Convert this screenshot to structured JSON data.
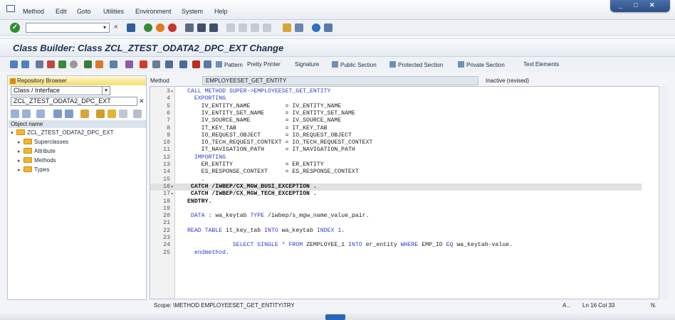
{
  "menu": {
    "items": [
      "Method",
      "Edit",
      "Goto",
      "Utilities",
      "Environment",
      "System",
      "Help"
    ]
  },
  "window_controls": [
    "_",
    "□",
    "✕"
  ],
  "command_field": {
    "value": "",
    "placeholder": ""
  },
  "title": "Class Builder: Class ZCL_ZTEST_ODATA2_DPC_EXT Change",
  "app_toolbar": {
    "pattern": "Pattern",
    "pretty_printer": "Pretty Printer",
    "signature": "Signature",
    "public_section": "Public Section",
    "protected_section": "Protected Section",
    "private_section": "Private Section",
    "text_elements": "Text Elements"
  },
  "left_pane": {
    "repository_browser": "Repository Browser",
    "object_type": "Class / Interface",
    "object_value": "ZCL_ZTEST_ODATA2_DPC_EXT",
    "object_name_header": "Object name",
    "tree": {
      "root": "ZCL_ZTEST_ODATA2_DPC_EXT",
      "children": [
        "Superclasses",
        "Attribute",
        "Methods",
        "Types"
      ]
    }
  },
  "editor_header": {
    "method_label": "Method",
    "method_name": "EMPLOYEESET_GET_ENTITY",
    "status": "Inactive (revised)"
  },
  "code": [
    {
      "n": "3",
      "mark": "▸",
      "text": "CALL METHOD SUPER->EMPLOYEESET_GET_ENTITY",
      "style": "kw"
    },
    {
      "n": "4",
      "mark": "",
      "text": "  EXPORTING",
      "style": "kw"
    },
    {
      "n": "5",
      "mark": "",
      "text": "    IV_ENTITY_NAME          = IV_ENTITY_NAME",
      "style": "plain"
    },
    {
      "n": "6",
      "mark": "",
      "text": "    IV_ENTITY_SET_NAME      = IV_ENTITY_SET_NAME",
      "style": "plain"
    },
    {
      "n": "7",
      "mark": "",
      "text": "    IV_SOURCE_NAME          = IV_SOURCE_NAME",
      "style": "plain"
    },
    {
      "n": "8",
      "mark": "",
      "text": "    IT_KEY_TAB              = IT_KEY_TAB",
      "style": "plain"
    },
    {
      "n": "9",
      "mark": "",
      "text": "    IO_REQUEST_OBJECT       = IO_REQUEST_OBJECT",
      "style": "plain"
    },
    {
      "n": "10",
      "mark": "",
      "text": "    IO_TECH_REQUEST_CONTEXT = IO_TECH_REQUEST_CONTEXT",
      "style": "plain"
    },
    {
      "n": "11",
      "mark": "",
      "text": "    IT_NAVIGATION_PATH      = IT_NAVIGATION_PATH",
      "style": "plain"
    },
    {
      "n": "12",
      "mark": "",
      "text": "  IMPORTING",
      "style": "kw"
    },
    {
      "n": "13",
      "mark": "",
      "text": "    ER_ENTITY               = ER_ENTITY",
      "style": "plain"
    },
    {
      "n": "14",
      "mark": "",
      "text": "    ES_RESPONSE_CONTEXT     = ES_RESPONSE_CONTEXT",
      "style": "plain"
    },
    {
      "n": "15",
      "mark": "",
      "text": "    .",
      "style": "plain"
    },
    {
      "n": "16",
      "mark": "▸",
      "text": " CATCH /IWBEP/CX_MGW_BUSI_EXCEPTION .",
      "style": "bold",
      "highlight": true
    },
    {
      "n": "17",
      "mark": "▸",
      "text": " CATCH /IWBEP/CX_MGW_TECH_EXCEPTION .",
      "style": "bold"
    },
    {
      "n": "18",
      "mark": "",
      "text": "ENDTRY.",
      "style": "bold"
    },
    {
      "n": "19",
      "mark": "",
      "text": "",
      "style": "plain"
    },
    {
      "n": "20",
      "mark": "",
      "text": " DATA : wa_keytab TYPE /iwbep/s_mgw_name_value_pair.",
      "style": "mixed1"
    },
    {
      "n": "21",
      "mark": "",
      "text": "",
      "style": "plain"
    },
    {
      "n": "22",
      "mark": "",
      "text": "READ TABLE it_key_tab INTO wa_keytab INDEX 1.",
      "style": "mixed2"
    },
    {
      "n": "23",
      "mark": "",
      "text": "",
      "style": "plain"
    },
    {
      "n": "24",
      "mark": "",
      "text": "             SELECT SINGLE * FROM ZEMPLOYEE_1 INTO er_entity WHERE EMP_ID EQ wa_keytab-value.",
      "style": "mixed3"
    },
    {
      "n": "25",
      "mark": "",
      "text": "  endmethod.",
      "style": "kw"
    }
  ],
  "status_bar": {
    "scope": "Scope: \\METHOD EMPLOYEESET_GET_ENTITY\\TRY",
    "mode": "A...",
    "position": "Ln  16 Col  33",
    "extra": "N."
  }
}
